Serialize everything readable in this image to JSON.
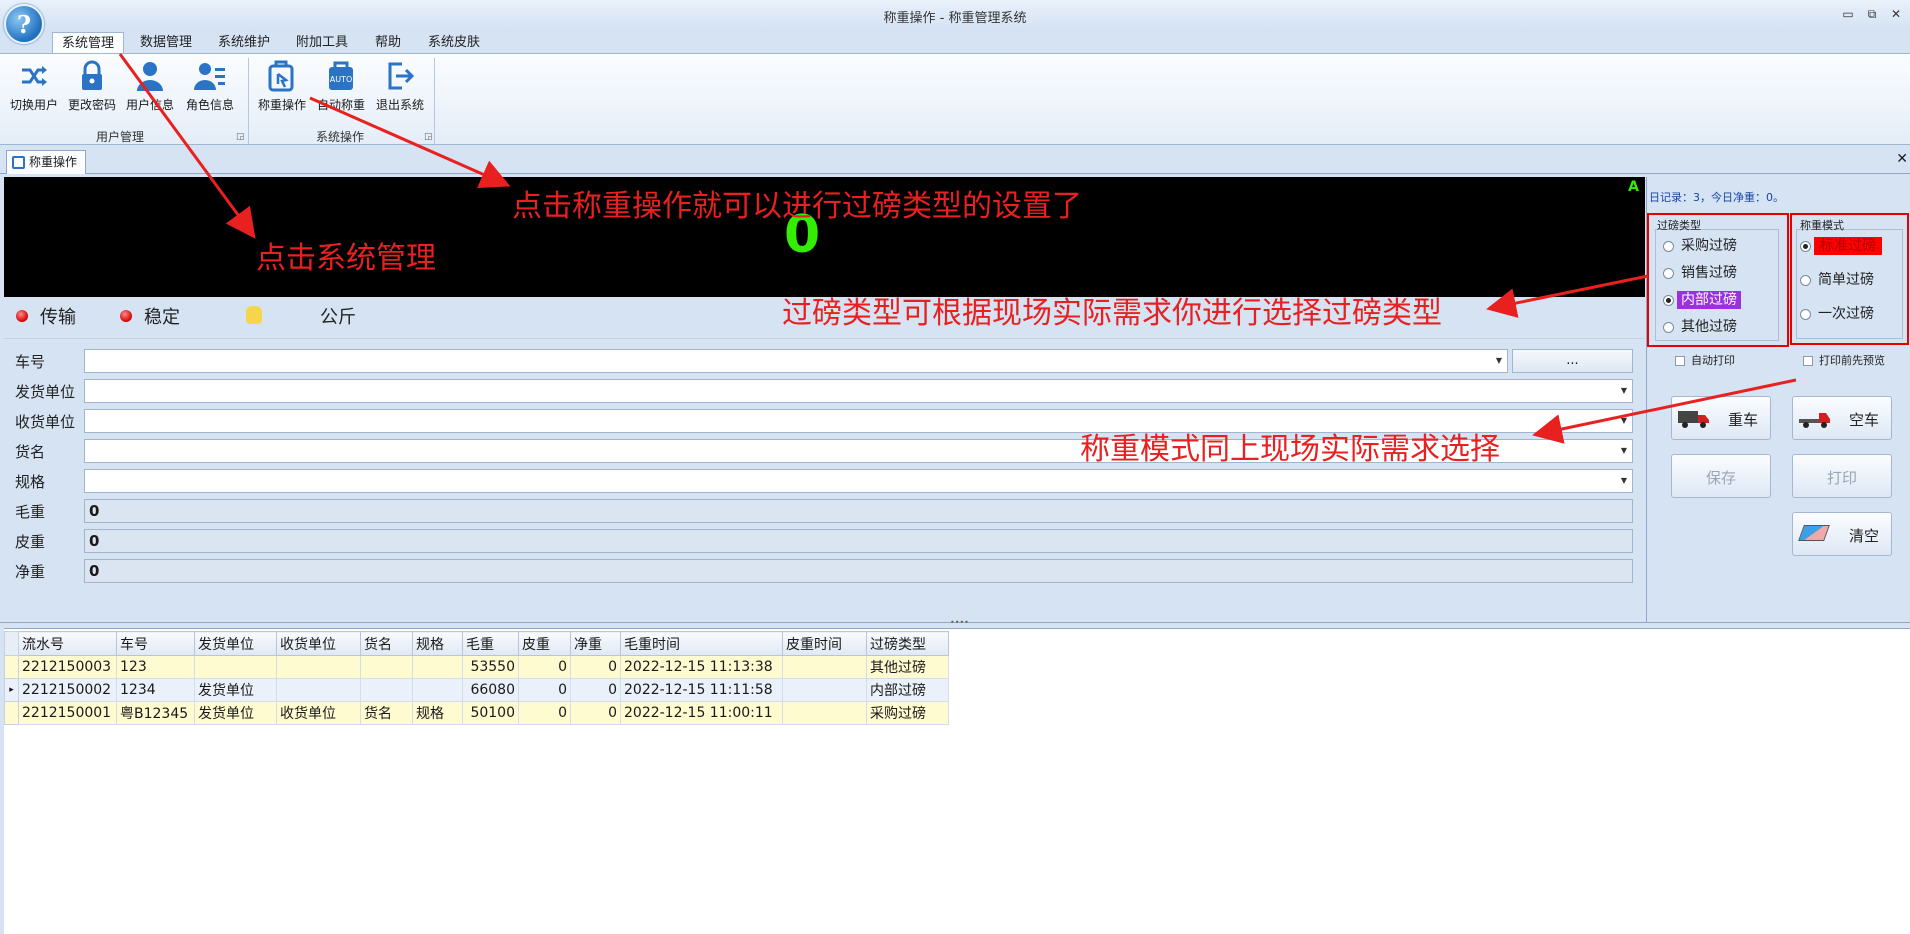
{
  "window": {
    "title": "称重操作 - 称重管理系统",
    "logo_glyph": "?"
  },
  "ribbon": {
    "tabs": [
      "系统管理",
      "数据管理",
      "系统维护",
      "附加工具",
      "帮助",
      "系统皮肤"
    ],
    "groups": {
      "user_mgmt": {
        "label": "用户管理",
        "buttons": [
          "切换用户",
          "更改密码",
          "用户信息",
          "角色信息"
        ]
      },
      "system_ops": {
        "label": "系统操作",
        "buttons": [
          "称重操作",
          "自动称重",
          "退出系统"
        ]
      }
    },
    "auto_badge": "AUTO"
  },
  "doc_tab": {
    "label": "称重操作"
  },
  "display": {
    "weight": "0",
    "indicator": "A"
  },
  "status": {
    "transmit": "传输",
    "stable": "稳定",
    "unit": "公斤"
  },
  "form": {
    "plate_label": "车号",
    "plate_more": "...",
    "sender_label": "发货单位",
    "receiver_label": "收货单位",
    "goods_label": "货名",
    "spec_label": "规格",
    "gross_label": "毛重",
    "gross_value": "0",
    "tare_label": "皮重",
    "tare_value": "0",
    "net_label": "净重",
    "net_value": "0"
  },
  "right_panel": {
    "summary": "日记录：3，今日净重：0。",
    "weigh_type": {
      "title": "过磅类型",
      "options": [
        "采购过磅",
        "销售过磅",
        "内部过磅",
        "其他过磅"
      ],
      "selected": "内部过磅"
    },
    "weigh_mode": {
      "title": "称重模式",
      "options": [
        "标准过磅",
        "简单过磅",
        "一次过磅"
      ],
      "selected": "标准过磅"
    },
    "auto_print": "自动打印",
    "preview": "打印前先预览",
    "buttons": {
      "heavy": "重车",
      "empty": "空车",
      "save": "保存",
      "print": "打印",
      "clear": "清空"
    }
  },
  "table": {
    "columns": [
      "流水号",
      "车号",
      "发货单位",
      "收货单位",
      "货名",
      "规格",
      "毛重",
      "皮重",
      "净重",
      "毛重时间",
      "皮重时间",
      "过磅类型"
    ],
    "rows": [
      [
        "2212150003",
        "123",
        "",
        "",
        "",
        "",
        "53550",
        "0",
        "0",
        "2022-12-15 11:13:38",
        "",
        "其他过磅"
      ],
      [
        "2212150002",
        "1234",
        "发货单位",
        "",
        "",
        "",
        "66080",
        "0",
        "0",
        "2022-12-15 11:11:58",
        "",
        "内部过磅"
      ],
      [
        "2212150001",
        "粤B12345",
        "发货单位",
        "收货单位",
        "货名",
        "规格",
        "50100",
        "0",
        "0",
        "2022-12-15 11:00:11",
        "",
        "采购过磅"
      ]
    ]
  },
  "annotations": {
    "a1": "点击系统管理",
    "a2": "点击称重操作就可以进行过磅类型的设置了",
    "a3": "过磅类型可根据现场实际需求你进行选择过磅类型",
    "a4": "称重模式同上现场实际需求选择"
  },
  "colors": {
    "annotation": "#e82020",
    "weight_display": "#33ee00",
    "highlight_purple": "#9b30e0",
    "highlight_red": "#ff0000"
  }
}
